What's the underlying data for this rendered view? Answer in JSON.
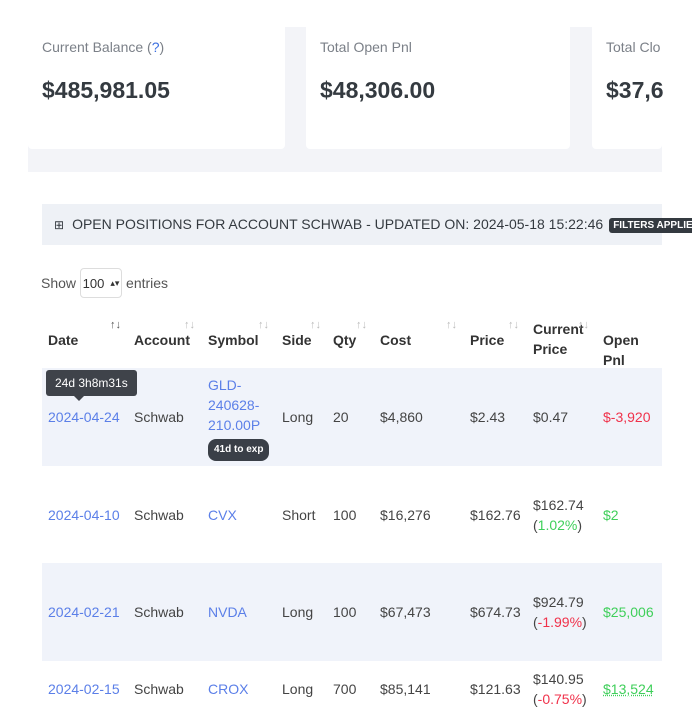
{
  "cards": [
    {
      "label": "Current Balance",
      "help": "?",
      "value": "$485,981.05"
    },
    {
      "label": "Total Open Pnl",
      "value": "$48,306.00"
    },
    {
      "label": "Total Clo",
      "value": "$37,6"
    }
  ],
  "header": {
    "icon": "table-icon",
    "title": "OPEN POSITIONS FOR ACCOUNT SCHWAB - UPDATED ON: 2024-05-18 15:22:46",
    "badge": "FILTERS APPLIED"
  },
  "length": {
    "show": "Show",
    "value": "100",
    "entries": "entries"
  },
  "columns": [
    "Date",
    "Account",
    "Symbol",
    "Side",
    "Qty",
    "Cost",
    "Price",
    "Current Price",
    "Open Pnl"
  ],
  "tooltip": "24d 3h8m31s",
  "rows": [
    {
      "date": "2024-04-24",
      "account": "Schwab",
      "symbol": "GLD-240628-210.00P",
      "badge": "41d to exp",
      "side": "Long",
      "qty": "20",
      "cost": "$4,860",
      "price": "$2.43",
      "current": "$0.47",
      "pnl": "$-3,920",
      "pnl_color": "red"
    },
    {
      "date": "2024-04-10",
      "account": "Schwab",
      "symbol": "CVX",
      "side": "Short",
      "qty": "100",
      "cost": "$16,276",
      "price": "$162.76",
      "current": "$162.74",
      "change": "1.02%",
      "change_color": "green",
      "pnl": "$2",
      "pnl_color": "green"
    },
    {
      "date": "2024-02-21",
      "account": "Schwab",
      "symbol": "NVDA",
      "side": "Long",
      "qty": "100",
      "cost": "$67,473",
      "price": "$674.73",
      "current": "$924.79",
      "change": "-1.99%",
      "change_color": "red",
      "pnl": "$25,006",
      "pnl_color": "green"
    },
    {
      "date": "2024-02-15",
      "account": "Schwab",
      "symbol": "CROX",
      "side": "Long",
      "qty": "700",
      "cost": "$85,141",
      "price": "$121.63",
      "current": "$140.95",
      "change": "-0.75%",
      "change_color": "red",
      "pnl": "$13,524",
      "pnl_color": "green"
    }
  ]
}
